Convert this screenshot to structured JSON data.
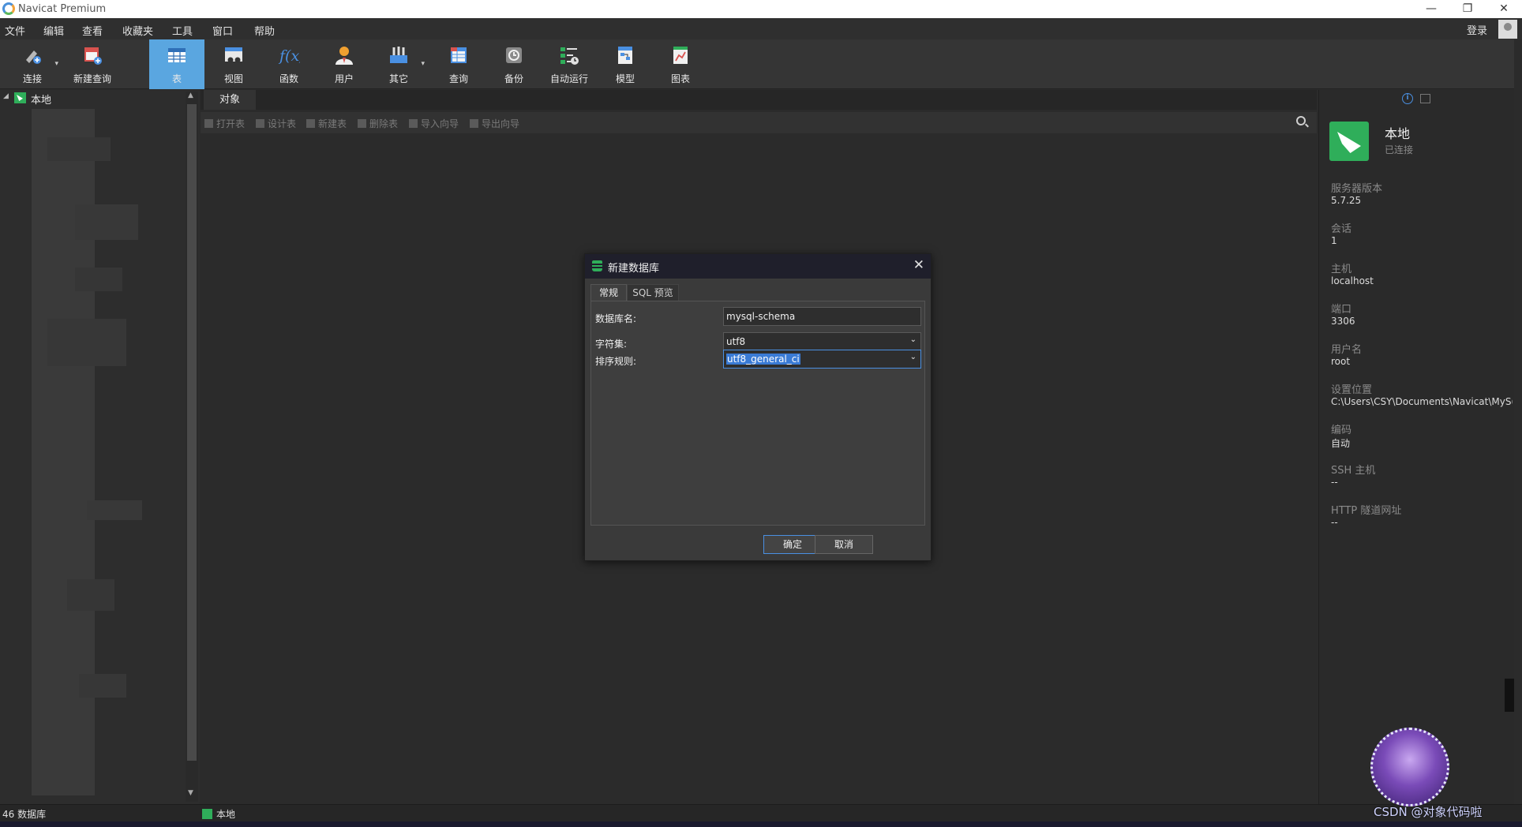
{
  "window": {
    "title": "Navicat Premium",
    "minimize": "—",
    "restore": "❐",
    "close": "✕"
  },
  "menu": {
    "items": [
      "文件",
      "编辑",
      "查看",
      "收藏夹",
      "工具",
      "窗口",
      "帮助"
    ],
    "login": "登录"
  },
  "toolbar": {
    "items": [
      {
        "label": "连接",
        "icon": "connection-icon"
      },
      {
        "label": "新建查询",
        "icon": "new-query-icon"
      },
      {
        "label": "表",
        "icon": "table-icon",
        "active": true
      },
      {
        "label": "视图",
        "icon": "view-icon"
      },
      {
        "label": "函数",
        "icon": "function-icon"
      },
      {
        "label": "用户",
        "icon": "user-icon"
      },
      {
        "label": "其它",
        "icon": "other-icon"
      },
      {
        "label": "查询",
        "icon": "query-icon"
      },
      {
        "label": "备份",
        "icon": "backup-icon"
      },
      {
        "label": "自动运行",
        "icon": "automation-icon"
      },
      {
        "label": "模型",
        "icon": "model-icon"
      },
      {
        "label": "图表",
        "icon": "chart-icon"
      }
    ],
    "dropdown_arrow": "▾"
  },
  "navigator": {
    "root_label": "本地",
    "expand_arrow": "◢",
    "scroll_up": "▲",
    "scroll_down": "▼"
  },
  "main": {
    "tab_objects": "对象",
    "actions": [
      "打开表",
      "设计表",
      "新建表",
      "删除表",
      "导入向导",
      "导出向导"
    ]
  },
  "info": {
    "conn_name": "本地",
    "conn_status": "已连接",
    "i_glyph": "i",
    "rows": [
      {
        "key": "服务器版本",
        "value": "5.7.25"
      },
      {
        "key": "会话",
        "value": "1"
      },
      {
        "key": "主机",
        "value": "localhost"
      },
      {
        "key": "端口",
        "value": "3306"
      },
      {
        "key": "用户名",
        "value": "root"
      },
      {
        "key": "设置位置",
        "value": "C:\\Users\\CSY\\Documents\\Navicat\\MyS("
      },
      {
        "key": "编码",
        "value": "自动"
      },
      {
        "key": "SSH 主机",
        "value": "--"
      },
      {
        "key": "HTTP 隧道网址",
        "value": "--"
      }
    ]
  },
  "statusbar": {
    "db_count": "46 数据库",
    "connection": "本地"
  },
  "dialog": {
    "title": "新建数据库",
    "close_glyph": "✕",
    "tab_general": "常规",
    "tab_sql": "SQL 预览",
    "db_name_label": "数据库名:",
    "db_name_value": "mysql-schema",
    "charset_label": "字符集:",
    "charset_value": "utf8",
    "collation_label": "排序规则:",
    "collation_value": "utf8_general_ci",
    "caret": "⌄",
    "ok": "确定",
    "cancel": "取消"
  },
  "watermark": {
    "text": "CSDN @对象代码啦"
  },
  "colors": {
    "accent": "#5aa6e0",
    "mysql_green": "#2fae5a",
    "link_blue": "#4a90e2"
  }
}
